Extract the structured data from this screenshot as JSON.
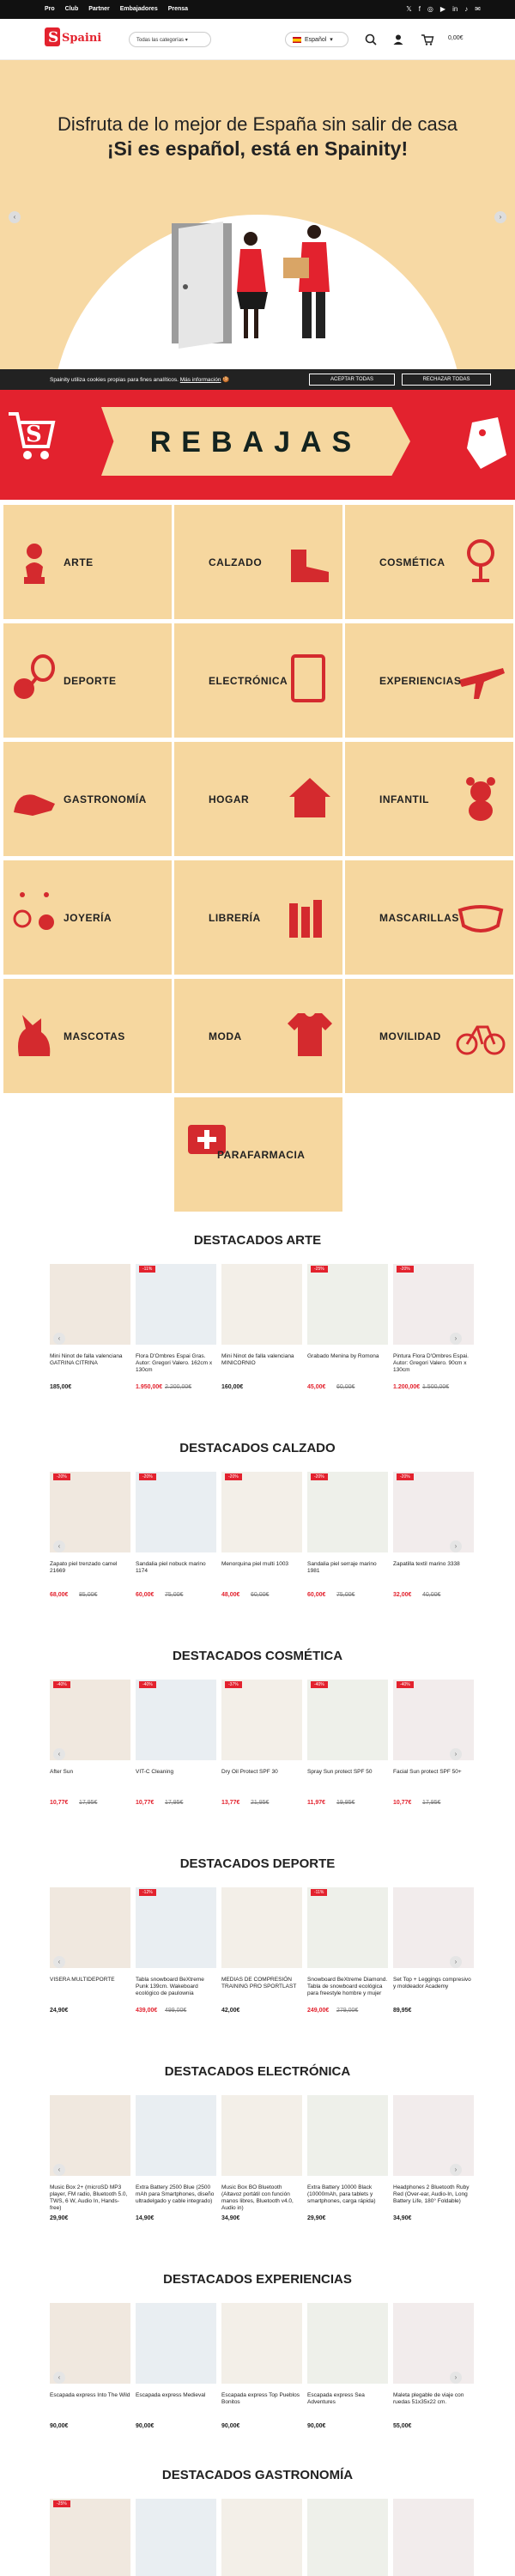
{
  "topbar": {
    "links": [
      "Pro",
      "Club",
      "Partner",
      "Embajadores",
      "Prensa"
    ],
    "social": [
      "twitter-icon",
      "facebook-icon",
      "instagram-icon",
      "youtube-icon",
      "linkedin-icon",
      "tiktok-icon",
      "mail-icon"
    ]
  },
  "header": {
    "logo_text": "Spainity",
    "categories_select": "Todas las categorías",
    "language": "Español",
    "cart_total": "0,00€"
  },
  "hero": {
    "line1": "Disfruta de lo mejor de España sin salir de casa",
    "line2": "¡Si es español, está en Spainity!"
  },
  "cookie": {
    "text": "Spainity utiliza cookies propias para fines analíticos.",
    "link": "Más información",
    "accept": "ACEPTAR TODAS",
    "reject": "RECHAZAR TODAS"
  },
  "promo": {
    "label": "REBAJAS"
  },
  "categories": [
    "ARTE",
    "CALZADO",
    "COSMÉTICA",
    "DEPORTE",
    "ELECTRÓNICA",
    "EXPERIENCIAS",
    "GASTRONOMÍA",
    "HOGAR",
    "INFANTIL",
    "JOYERÍA",
    "LIBRERÍA",
    "MASCARILLAS",
    "MASCOTAS",
    "MODA",
    "MOVILIDAD",
    "PARAFARMACIA"
  ],
  "sections": [
    {
      "title": "DESTACADOS ARTE",
      "products": [
        {
          "name": "Mini Ninot de falla valenciana GATRINA CITRINA",
          "price": "185,00€",
          "old": "",
          "badge": ""
        },
        {
          "name": "Flora D'Ombres Espai Gras. Autor: Gregori Valero. 162cm x 130cm",
          "price": "1.950,00€",
          "old": "2.200,00€",
          "badge": "-11%"
        },
        {
          "name": "Mini Ninot de falla valenciana MINICORNIO",
          "price": "160,00€",
          "old": "",
          "badge": ""
        },
        {
          "name": "Grabado Menina by Romona",
          "price": "45,00€",
          "old": "60,00€",
          "badge": "-25%"
        },
        {
          "name": "Pintura Flora D'Ombres Espai. Autor: Gregori Valero. 90cm x 130cm",
          "price": "1.200,00€",
          "old": "1.500,00€",
          "badge": "-20%"
        }
      ]
    },
    {
      "title": "DESTACADOS CALZADO",
      "products": [
        {
          "name": "Zapato piel trenzado camel 21669",
          "price": "68,00€",
          "old": "85,00€",
          "badge": "-20%"
        },
        {
          "name": "Sandalia piel nobuck marino 1174",
          "price": "60,00€",
          "old": "75,00€",
          "badge": "-20%"
        },
        {
          "name": "Menorquina piel multi 1003",
          "price": "48,00€",
          "old": "60,00€",
          "badge": "-20%"
        },
        {
          "name": "Sandalia piel serraje marino 1981",
          "price": "60,00€",
          "old": "75,00€",
          "badge": "-20%"
        },
        {
          "name": "Zapatilla textil marino 3338",
          "price": "32,00€",
          "old": "40,00€",
          "badge": "-20%"
        }
      ]
    },
    {
      "title": "DESTACADOS COSMÉTICA",
      "products": [
        {
          "name": "After Sun",
          "price": "10,77€",
          "old": "17,95€",
          "badge": "-40%"
        },
        {
          "name": "VIT-C Cleaning",
          "price": "10,77€",
          "old": "17,95€",
          "badge": "-40%"
        },
        {
          "name": "Dry Oil Protect SPF 30",
          "price": "13,77€",
          "old": "21,95€",
          "badge": "-37%"
        },
        {
          "name": "Spray Sun protect SPF 50",
          "price": "11,97€",
          "old": "19,95€",
          "badge": "-40%"
        },
        {
          "name": "Facial Sun protect SPF 50+",
          "price": "10,77€",
          "old": "17,95€",
          "badge": "-40%"
        }
      ]
    },
    {
      "title": "DESTACADOS DEPORTE",
      "products": [
        {
          "name": "VISERA MULTIDEPORTE",
          "price": "24,90€",
          "old": "",
          "badge": ""
        },
        {
          "name": "Tabla snowboard BeXtreme Punk 139cm. Wakeboard ecológico de paulownia",
          "price": "439,00€",
          "old": "499,00€",
          "badge": "-12%"
        },
        {
          "name": "MEDIAS DE COMPRESIÓN TRAINING PRO SPORTLAST",
          "price": "42,00€",
          "old": "",
          "badge": ""
        },
        {
          "name": "Snowboard BeXtreme Diamond. Tabla de snowboard ecológica para freestyle hombre y mujer",
          "price": "249,00€",
          "old": "279,00€",
          "badge": "-11%"
        },
        {
          "name": "Set Top + Leggings compresivo y moldeador Academy",
          "price": "89,95€",
          "old": "",
          "badge": ""
        }
      ]
    },
    {
      "title": "DESTACADOS ELECTRÓNICA",
      "products": [
        {
          "name": "Music Box 2+ (microSD MP3 player, FM radio, Bluetooth 5.0, TWS, 6 W, Audio In, Hands-free)",
          "price": "29,90€",
          "old": "",
          "badge": ""
        },
        {
          "name": "Extra Battery 2500 Blue (2500 mAh para Smartphones, diseño ultradelgado y cable integrado)",
          "price": "14,90€",
          "old": "",
          "badge": ""
        },
        {
          "name": "Music Box BO Bluetooth (Altavoz portátil con función manos libres, Bluetooth v4.0, Audio in)",
          "price": "34,90€",
          "old": "",
          "badge": ""
        },
        {
          "name": "Extra Battery 10000 Black (10000mAh, para tablets y smartphones, carga rápida)",
          "price": "29,90€",
          "old": "",
          "badge": ""
        },
        {
          "name": "Headphones 2 Bluetooth Ruby Red (Over-ear, Audio-In, Long Battery Life, 180° Foldable)",
          "price": "34,90€",
          "old": "",
          "badge": ""
        }
      ]
    },
    {
      "title": "DESTACADOS EXPERIENCIAS",
      "products": [
        {
          "name": "Escapada express Into The Wild",
          "price": "90,00€",
          "old": "",
          "badge": ""
        },
        {
          "name": "Escapada express Medieval",
          "price": "90,00€",
          "old": "",
          "badge": ""
        },
        {
          "name": "Escapada express Top Pueblos Bonitos",
          "price": "90,00€",
          "old": "",
          "badge": ""
        },
        {
          "name": "Escapada express Sea Adventures",
          "price": "90,00€",
          "old": "",
          "badge": ""
        },
        {
          "name": "Maleta plegable de viaje con ruedas 51x35x22 cm.",
          "price": "55,00€",
          "old": "",
          "badge": ""
        }
      ]
    },
    {
      "title": "DESTACADOS GASTRONOMÍA",
      "products": [
        {
          "name": "",
          "price": "",
          "old": "",
          "badge": "-25%"
        },
        {
          "name": "",
          "price": "",
          "old": "",
          "badge": ""
        },
        {
          "name": "",
          "price": "",
          "old": "",
          "badge": ""
        },
        {
          "name": "",
          "price": "",
          "old": "",
          "badge": ""
        },
        {
          "name": "",
          "price": "",
          "old": "",
          "badge": ""
        }
      ]
    }
  ],
  "colors": {
    "brand_red": "#e3222e",
    "tile_bg": "#f6d79f",
    "hero_bg": "#f7d9a4",
    "dark": "#111111"
  }
}
